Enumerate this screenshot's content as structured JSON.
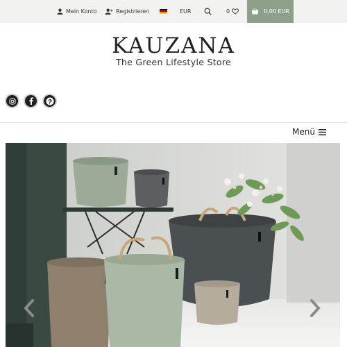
{
  "topbar": {
    "account_label": "Mein Konto",
    "register_label": "Registrieren",
    "currency": "EUR",
    "wishlist_count": "0",
    "cart_total": "0,00 EUR"
  },
  "brand": {
    "name": "KAUZANA",
    "tagline": "The Green Lifestyle Store"
  },
  "nav": {
    "menu_label": "Menü"
  },
  "icons": [
    "user-icon",
    "add-user-icon",
    "german-flag-icon",
    "search-icon",
    "heart-icon",
    "basket-icon",
    "instagram-icon",
    "facebook-icon",
    "pinterest-icon",
    "hamburger-icon",
    "chevron-left-icon",
    "chevron-right-icon"
  ],
  "colors": {
    "cart_bg": "#8ea089",
    "topbar_bg": "#f2f2f1"
  }
}
